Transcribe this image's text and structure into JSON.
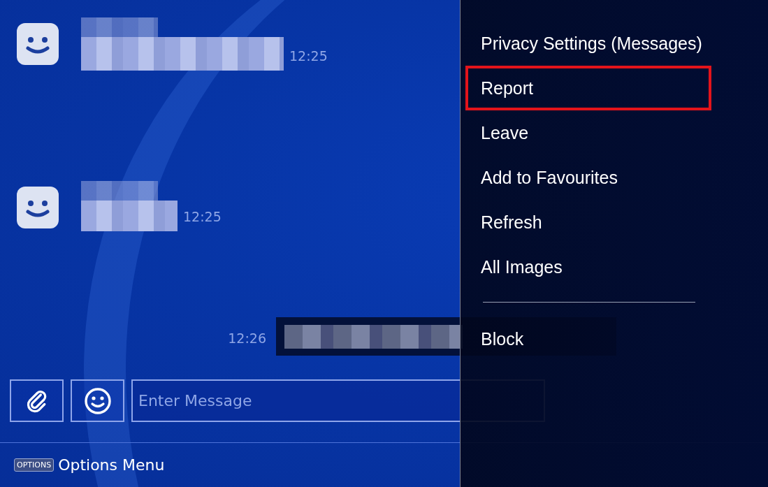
{
  "conversation": [
    {
      "kind": "received_long",
      "time": "12:25"
    },
    {
      "kind": "received_short",
      "time": "12:25"
    },
    {
      "kind": "sent",
      "time": "12:26"
    }
  ],
  "composer": {
    "placeholder": "Enter Message"
  },
  "footer": {
    "button_badge": "OPTIONS",
    "hint": "Options Menu"
  },
  "options_menu": {
    "items": [
      {
        "label": "Privacy Settings (Messages)",
        "annotated": false
      },
      {
        "label": "Report",
        "annotated": true
      },
      {
        "label": "Leave",
        "annotated": false
      },
      {
        "label": "Add to Favourites",
        "annotated": false
      },
      {
        "label": "Refresh",
        "annotated": false
      },
      {
        "label": "All Images",
        "annotated": false
      }
    ],
    "after_divider": [
      {
        "label": "Block",
        "annotated": false
      }
    ]
  }
}
